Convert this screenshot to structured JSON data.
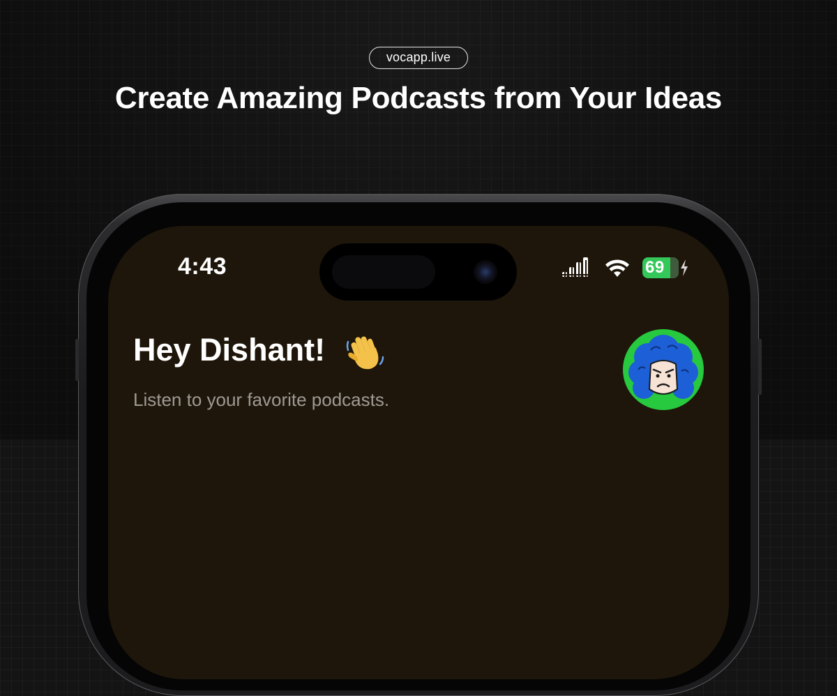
{
  "banner": {
    "url_label": "vocapp.live",
    "headline": "Create Amazing Podcasts from Your Ideas"
  },
  "status_bar": {
    "time": "4:43",
    "battery_level": "69",
    "icons": [
      "cellular-signal-icon",
      "wifi-icon",
      "battery-icon",
      "charging-bolt-icon"
    ]
  },
  "home": {
    "greeting": "Hey Dishant!",
    "greeting_emoji": "waving-hand-icon",
    "subtitle": "Listen to your favorite podcasts.",
    "avatar": "user-avatar"
  },
  "colors": {
    "page_background": "#141414",
    "screen_background": "#1e160a",
    "battery_green": "#34c759",
    "avatar_ring": "#27c93f",
    "avatar_hair": "#1d5fd6",
    "subtitle_text": "#9e9a94"
  }
}
